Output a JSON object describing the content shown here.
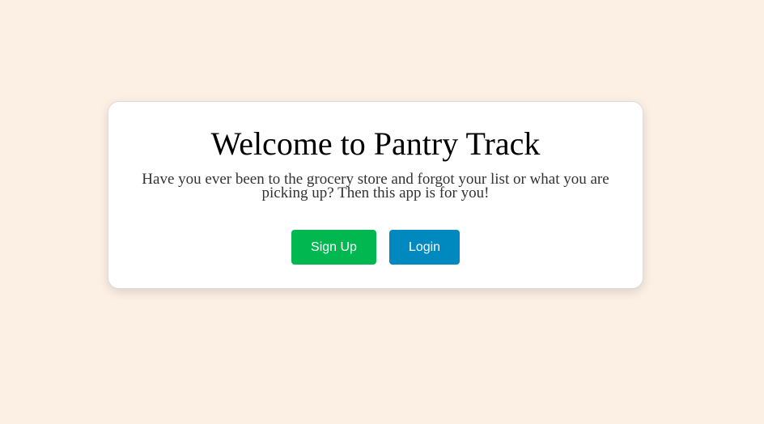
{
  "welcome": {
    "title": "Welcome to Pantry Track",
    "subtitle": "Have you ever been to the grocery store and forgot your list or what you are picking up? Then this app is for you!",
    "signup_label": "Sign Up",
    "login_label": "Login"
  },
  "colors": {
    "background": "#fcefe3",
    "card": "#ffffff",
    "signup_button": "#00b84f",
    "login_button": "#0089bf"
  }
}
